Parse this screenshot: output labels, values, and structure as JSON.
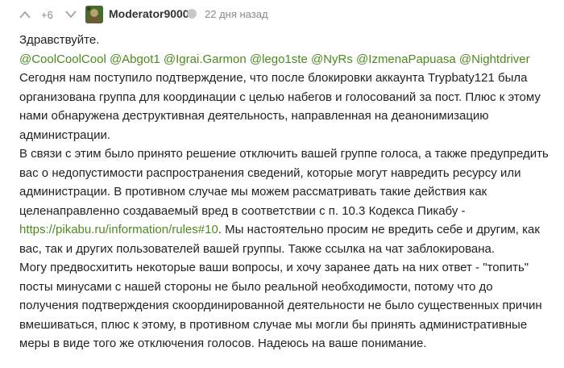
{
  "header": {
    "rating": "+6",
    "username": "Moderator9000",
    "timestamp": "22 дня назад"
  },
  "icons": {
    "vote_up": "chevron-up-icon",
    "vote_down": "chevron-down-icon",
    "avatar": "avatar-image",
    "moderator": "moderator-badge-icon"
  },
  "colors": {
    "link": "#4d8a1e",
    "meta": "#8a8a8a",
    "text": "#222222"
  },
  "body": {
    "greeting": "Здравствуйте.",
    "mentions": [
      "@CoolCoolCool",
      "@Abgot1",
      "@Igrai.Garmon",
      "@lego1ste",
      "@NyRs",
      "@IzmenaPapuasa",
      "@Nightdriver"
    ],
    "p1": "Сегодня нам поступило подтверждение, что после блокировки аккаунта Trypbaty121 была организована группа для координации с целью набегов и голосований за пост. Плюс к этому нами обнаружена деструктивная деятельность, направленная на деанонимизацию администрации.",
    "p2_before": "В связи с этим было принято решение отключить вашей группе голоса, а также предупредить вас о недопустимости распространения сведений, которые могут навредить ресурсу или администрации. В противном случае мы можем рассматривать такие действия как целенаправленно создаваемый вред в соответствии с п. 10.3 Кодекса Пикабу -",
    "p2_link": "https://pikabu.ru/information/rules#10",
    "p2_after": ". Мы настоятельно просим не вредить себе и другим, как вас, так и других пользователей вашей группы. Также ссылка на чат заблокирована.",
    "p3": "Могу предвосхитить некоторые ваши вопросы, и хочу заранее дать на них ответ - \"топить\" посты минусами с нашей стороны не было реальной необходимости, потому что до получения подтверждения скоординированной деятельности не было существенных причин вмешиваться, плюс к этому, в противном случае мы могли бы принять административные меры в виде того же отключения голосов. Надеюсь на ваше понимание."
  }
}
